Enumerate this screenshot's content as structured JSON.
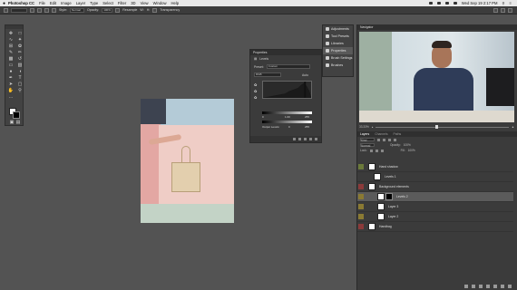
{
  "menubar": {
    "apple": "",
    "app": "Photoshop CC",
    "items": [
      "File",
      "Edit",
      "Image",
      "Layer",
      "Type",
      "Select",
      "Filter",
      "3D",
      "View",
      "Window",
      "Help"
    ],
    "clock": "Wed Sep 19 2:17 PM"
  },
  "options": {
    "style_label": "Style:",
    "style_value": "Normal",
    "opacity_label": "Opacity:",
    "opacity_value": "100%",
    "resample": "Resample",
    "width_label": "W:",
    "height_label": "H:",
    "transparency": "Transparency"
  },
  "properties": {
    "title": "Properties",
    "sub": "Levels",
    "preset_label": "Preset:",
    "preset_value": "Custom",
    "channel": "RGB",
    "auto": "Auto",
    "in_low": "0",
    "in_mid": "1.00",
    "in_high": "255",
    "out_label": "Output Levels:",
    "out_low": "0",
    "out_high": "255"
  },
  "adjpanel": {
    "items": [
      "Adjustments",
      "Tool Presets",
      "Libraries",
      "Properties",
      "Brush Settings",
      "Brushes"
    ],
    "active_index": 3
  },
  "navigator": {
    "title": "Navigator",
    "zoom": "33.33%"
  },
  "layers": {
    "tabs": [
      "Layers",
      "Channels",
      "Paths"
    ],
    "kind": "Kind",
    "blend": "Normal",
    "opacity_label": "Opacity:",
    "opacity_value": "100%",
    "lock_label": "Lock:",
    "fill_label": "Fill:",
    "fill_value": "100%",
    "items": [
      {
        "name": "Hand shadow",
        "eye": "green"
      },
      {
        "name": "Levels 1",
        "eye": "none"
      },
      {
        "name": "Background elements",
        "eye": "red"
      },
      {
        "name": "Levels 2",
        "eye": "yellow"
      },
      {
        "name": "Layer 3",
        "eye": "yellow"
      },
      {
        "name": "Layer 2",
        "eye": "yellow"
      },
      {
        "name": "Handbag",
        "eye": "red"
      }
    ],
    "selected_index": 3
  },
  "colors": {
    "eye_green": "#6b7a3a",
    "eye_red": "#8b3a3a",
    "eye_yellow": "#8a7a33"
  }
}
